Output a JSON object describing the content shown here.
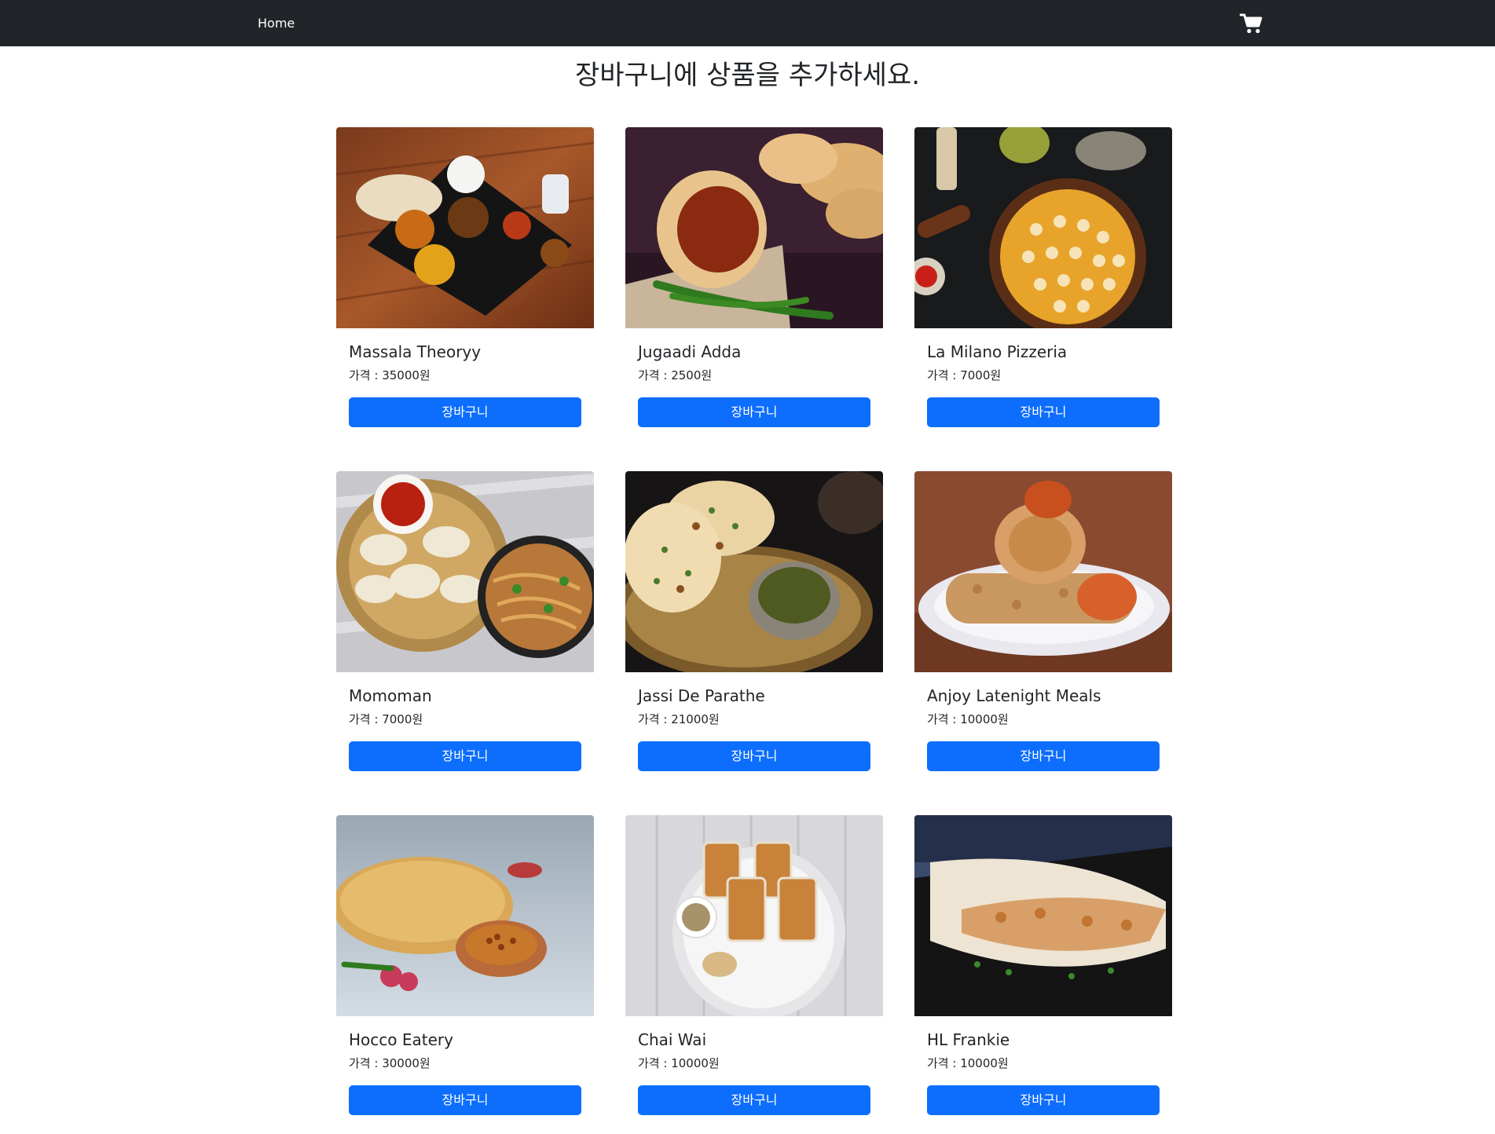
{
  "navbar": {
    "home_label": "Home",
    "cart_icon": "shopping-cart-icon"
  },
  "page": {
    "title": "장바구니에 상품을 추가하세요."
  },
  "products": [
    {
      "name": "Massala Theoryy",
      "price": "가격 : 35000원",
      "button": "장바구니",
      "image": "thali-platter"
    },
    {
      "name": "Jugaadi Adda",
      "price": "가격 : 2500원",
      "button": "장바구니",
      "image": "vada-pav"
    },
    {
      "name": "La Milano Pizzeria",
      "price": "가격 : 7000원",
      "button": "장바구니",
      "image": "pizza"
    },
    {
      "name": "Momoman",
      "price": "가격 : 7000원",
      "button": "장바구니",
      "image": "momos-noodles"
    },
    {
      "name": "Jassi De Parathe",
      "price": "가격 : 21000원",
      "button": "장바구니",
      "image": "paratha"
    },
    {
      "name": "Anjoy Latenight Meals",
      "price": "가격 : 10000원",
      "button": "장바구니",
      "image": "wrap-rolls"
    },
    {
      "name": "Hocco Eatery",
      "price": "가격 : 30000원",
      "button": "장바구니",
      "image": "kulcha-chole"
    },
    {
      "name": "Chai Wai",
      "price": "가격 : 10000원",
      "button": "장바구니",
      "image": "chai-glasses"
    },
    {
      "name": "HL Frankie",
      "price": "가격 : 10000원",
      "button": "장바구니",
      "image": "frankie-roll"
    }
  ],
  "colors": {
    "navbar": "#212529",
    "button": "#0d6efd",
    "text": "#212529"
  }
}
